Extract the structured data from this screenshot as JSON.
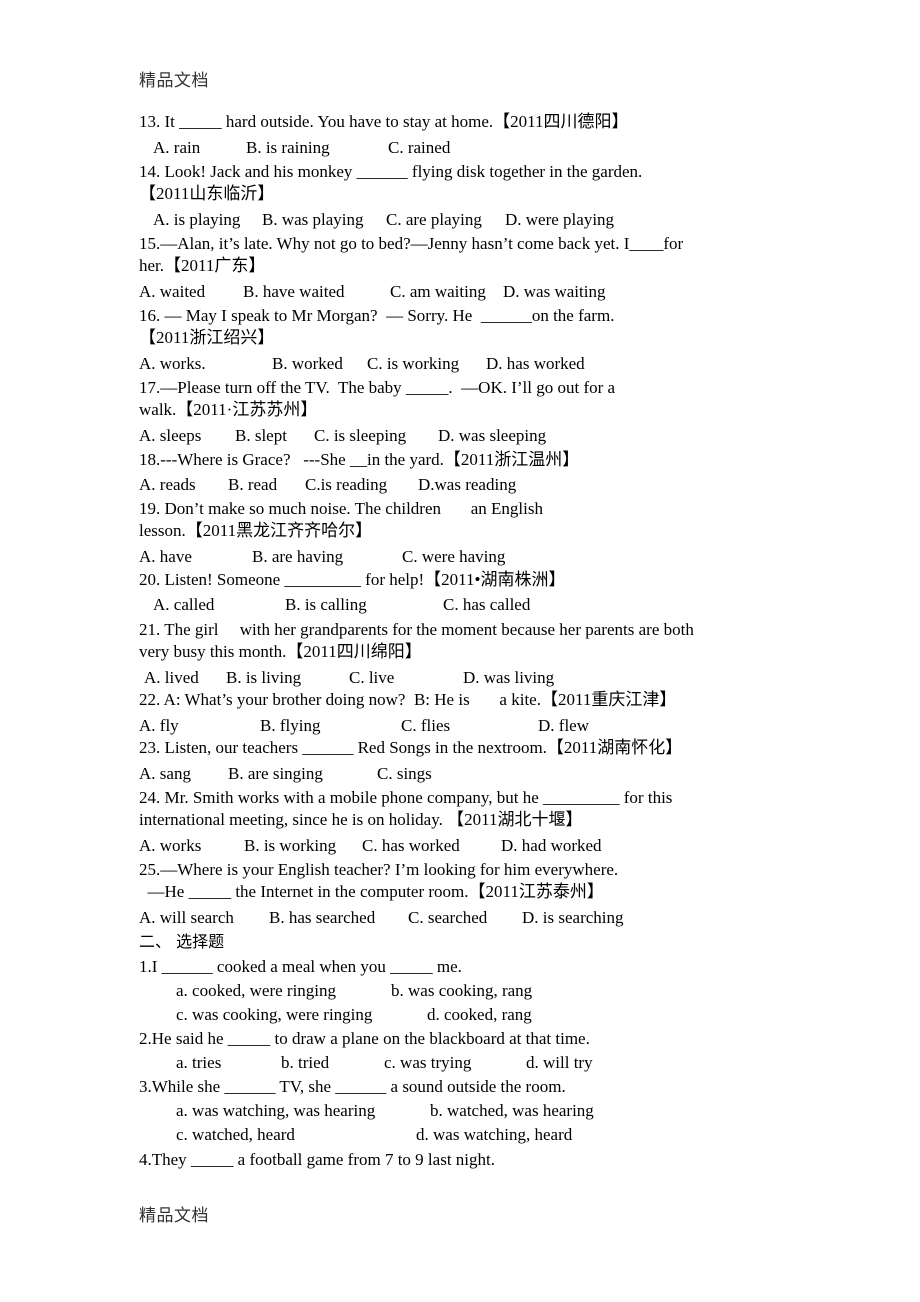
{
  "header": {
    "watermark": "精品文档"
  },
  "footer": {
    "watermark": "精品文档"
  },
  "section1": {
    "questions": [
      {
        "num": "13",
        "lines": [
          "13. It _____ hard outside. You have to stay at home.【2011四川德阳】"
        ],
        "options": [
          "A. rain",
          "B. is raining",
          "C. rained"
        ]
      },
      {
        "num": "14",
        "lines": [
          "14. Look! Jack and his monkey ______ flying disk together in the garden.",
          "【2011山东临沂】"
        ],
        "options": [
          "A. is playing",
          "B. was playing",
          "C. are playing",
          "D. were playing"
        ]
      },
      {
        "num": "15",
        "lines": [
          "15.—Alan, it’s late. Why not go to bed?—Jenny hasn’t come back yet. I____for",
          "her.【2011广东】"
        ],
        "options": [
          "A. waited",
          "B. have waited",
          "C. am waiting",
          "D. was waiting"
        ]
      },
      {
        "num": "16",
        "lines": [
          "16. — May I speak to Mr Morgan?  — Sorry. He  ______on the farm.",
          "【2011浙江绍兴】"
        ],
        "options": [
          "A. works.",
          "B. worked",
          "C. is working",
          "D. has worked"
        ]
      },
      {
        "num": "17",
        "lines": [
          "17.—Please turn off the TV.  The baby _____.  —OK. I’ll go out for a",
          "walk.【2011·江苏苏州】"
        ],
        "options": [
          "A. sleeps",
          "B. slept",
          "C. is sleeping",
          "D. was sleeping"
        ]
      },
      {
        "num": "18",
        "lines": [
          "18.---Where is Grace?   ---She __in the yard.【2011浙江温州】"
        ],
        "options": [
          "A. reads",
          "B. read",
          "C.is reading",
          "D.was reading"
        ]
      },
      {
        "num": "19",
        "lines": [
          "19. Don’t make so much noise. The children       an English",
          "lesson.【2011黑龙江齐齐哈尔】"
        ],
        "options": [
          "A. have",
          "B. are having",
          "C. were having"
        ]
      },
      {
        "num": "20",
        "lines": [
          "20. Listen! Someone _________ for help!【2011•湖南株洲】"
        ],
        "options": [
          "A. called",
          "B. is calling",
          "C. has called"
        ]
      },
      {
        "num": "21",
        "lines": [
          "21. The girl     with her grandparents for the moment because her parents are both",
          "very busy this month.【2011四川绵阳】"
        ],
        "options": [
          "A. lived",
          "B. is living",
          "C. live",
          "D. was living"
        ]
      },
      {
        "num": "22",
        "lines": [
          "22. A: What’s your brother doing now?  B: He is       a kite.【2011重庆江津】"
        ],
        "options": [
          "A. fly",
          "B. flying",
          "C. flies",
          "D. flew"
        ]
      },
      {
        "num": "23",
        "lines": [
          "23. Listen, our teachers ______ Red Songs in the nextroom.【2011湖南怀化】"
        ],
        "options": [
          "A. sang",
          "B. are singing",
          "C. sings"
        ]
      },
      {
        "num": "24",
        "lines": [
          "24. Mr. Smith works with a mobile phone company, but he _________ for this",
          "international meeting, since he is on holiday. 【2011湖北十堰】"
        ],
        "options": [
          "A. works",
          "B. is working",
          "C. has worked",
          "D. had worked"
        ]
      },
      {
        "num": "25",
        "lines": [
          "25.—Where is your English teacher? I’m looking for him everywhere.",
          "  —He _____ the Internet in the computer room.【2011江苏泰州】"
        ],
        "options": [
          "A. will search",
          "B. has searched",
          "C. searched",
          "D. is searching"
        ]
      }
    ]
  },
  "section2": {
    "title": "二、 选择题",
    "questions": [
      {
        "num": "1",
        "stem": "1.I ______ cooked a meal when you _____ me.",
        "options": [
          "a. cooked, were ringing",
          "b. was cooking, rang",
          "c. was cooking, were ringing",
          "d. cooked, rang"
        ]
      },
      {
        "num": "2",
        "stem": "2.He said he _____ to draw a plane on the blackboard at that time.",
        "options": [
          "a. tries",
          "b. tried",
          "c. was trying",
          "d. will try"
        ]
      },
      {
        "num": "3",
        "stem": "3.While she ______ TV, she ______ a sound outside the room.",
        "options": [
          "a. was watching, was hearing",
          "b. watched, was hearing",
          "c. watched, heard",
          "d. was watching, heard"
        ]
      },
      {
        "num": "4",
        "stem": "4.They _____ a football game from 7 to 9 last night.",
        "options": []
      }
    ]
  }
}
